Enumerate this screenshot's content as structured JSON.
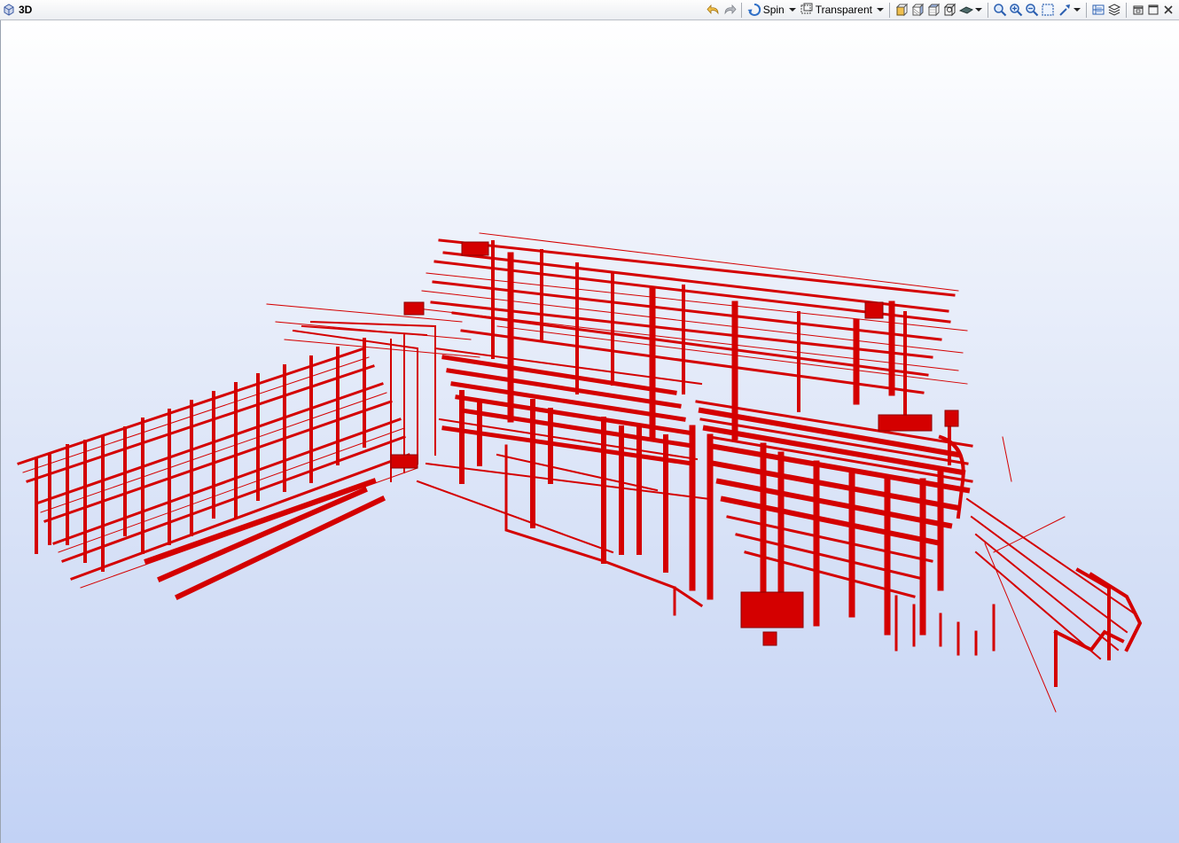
{
  "window": {
    "title": "3D",
    "view_icon": "3d-view-icon"
  },
  "toolbar": {
    "spin_label": "Spin",
    "display_mode_label": "Transparent",
    "icons": [
      "undo-icon",
      "redo-icon",
      "spin-icon",
      "display-mode-icon",
      "view-cube-front-icon",
      "view-cube-side-icon",
      "view-cube-top-icon",
      "view-cube-iso-icon",
      "render-style-icon",
      "zoom-icon",
      "zoom-in-icon",
      "zoom-out-icon",
      "zoom-window-icon",
      "pick-icon",
      "section-icon",
      "layers-icon",
      "restore-icon",
      "maximize-icon",
      "close-icon"
    ]
  },
  "viewport": {
    "background_top": "#ffffff",
    "background_bottom": "#c2d2f5",
    "model_color": "#d40000"
  }
}
